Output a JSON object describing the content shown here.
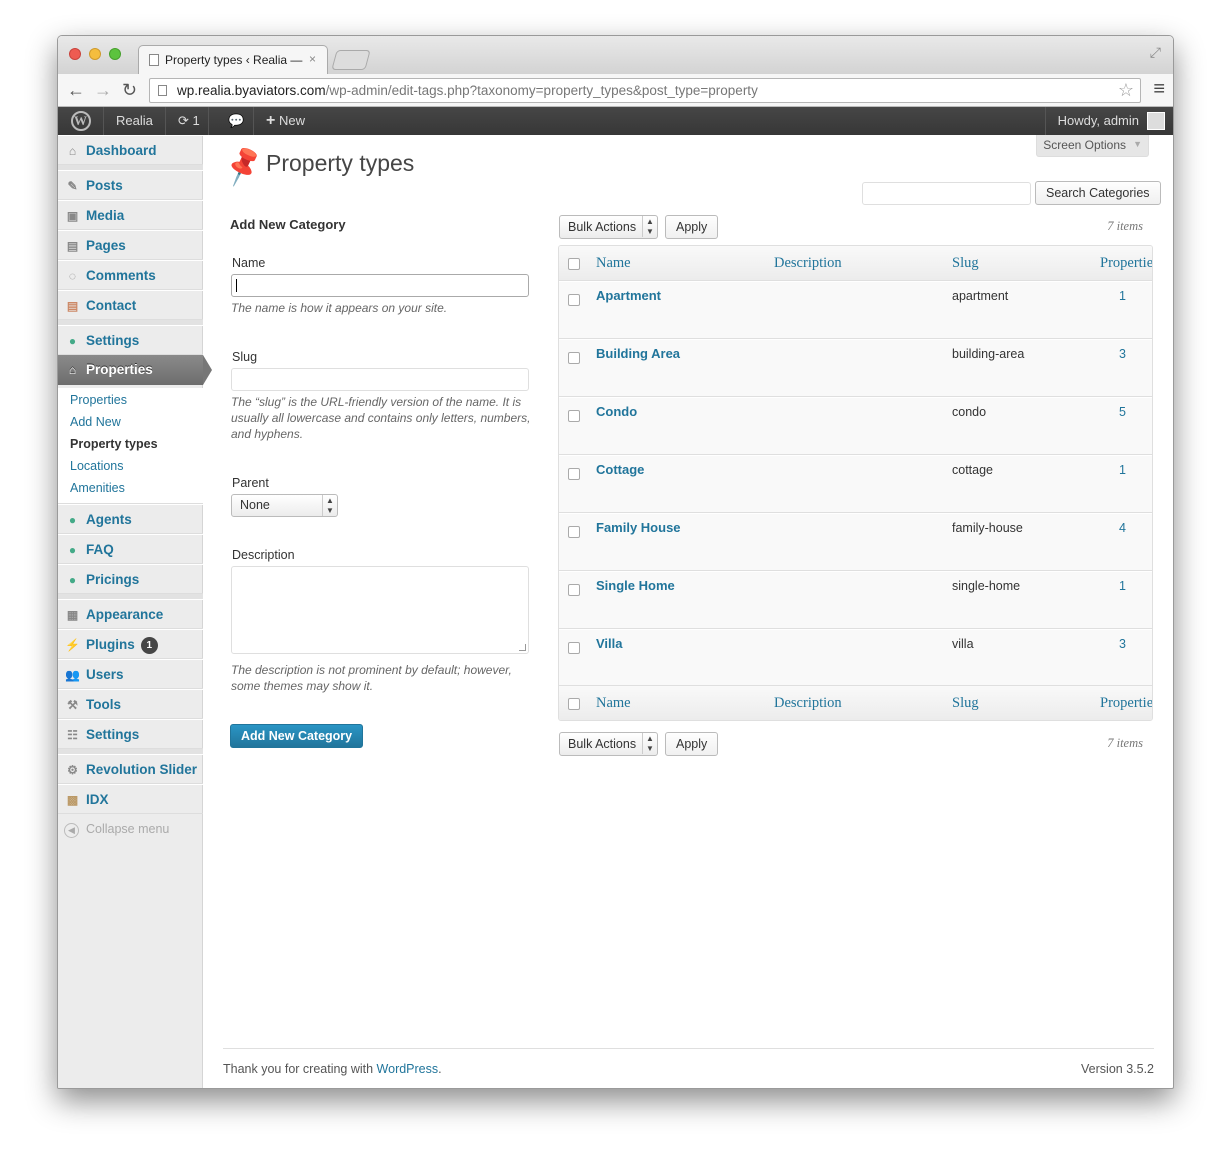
{
  "browser": {
    "tab_title": "Property types ‹ Realia — V",
    "tab_close": "×",
    "url_domain": "wp.realia.byaviators.com",
    "url_path": "/wp-admin/edit-tags.php?taxonomy=property_types&post_type=property"
  },
  "adminbar": {
    "site_name": "Realia",
    "updates_count": "1",
    "new_label": "New",
    "howdy": "Howdy, admin"
  },
  "sidebar": {
    "dashboard": "Dashboard",
    "posts": "Posts",
    "media": "Media",
    "pages": "Pages",
    "comments": "Comments",
    "contact": "Contact",
    "settings_top": "Settings",
    "properties": "Properties",
    "submenu": [
      "Properties",
      "Add New",
      "Property types",
      "Locations",
      "Amenities"
    ],
    "agents": "Agents",
    "faq": "FAQ",
    "pricings": "Pricings",
    "appearance": "Appearance",
    "plugins": "Plugins",
    "plugins_badge": "1",
    "users": "Users",
    "tools": "Tools",
    "settings": "Settings",
    "revolution_slider": "Revolution Slider",
    "idx": "IDX",
    "collapse": "Collapse menu"
  },
  "page": {
    "screen_options": "Screen Options",
    "title": "Property types",
    "search_button": "Search Categories"
  },
  "form": {
    "heading": "Add New Category",
    "name_label": "Name",
    "name_help": "The name is how it appears on your site.",
    "slug_label": "Slug",
    "slug_help": "The “slug” is the URL-friendly version of the name. It is usually all lowercase and contains only letters, numbers, and hyphens.",
    "parent_label": "Parent",
    "parent_value": "None",
    "description_label": "Description",
    "description_help": "The description is not prominent by default; however, some themes may show it.",
    "submit": "Add New Category"
  },
  "table": {
    "bulk_actions": "Bulk Actions",
    "apply": "Apply",
    "items_count": "7 items",
    "columns": [
      "Name",
      "Description",
      "Slug",
      "Properties"
    ],
    "rows": [
      {
        "name": "Apartment",
        "slug": "apartment",
        "count": "1"
      },
      {
        "name": "Building Area",
        "slug": "building-area",
        "count": "3"
      },
      {
        "name": "Condo",
        "slug": "condo",
        "count": "5"
      },
      {
        "name": "Cottage",
        "slug": "cottage",
        "count": "1"
      },
      {
        "name": "Family House",
        "slug": "family-house",
        "count": "4"
      },
      {
        "name": "Single Home",
        "slug": "single-home",
        "count": "1"
      },
      {
        "name": "Villa",
        "slug": "villa",
        "count": "3"
      }
    ]
  },
  "footer": {
    "thanks_prefix": "Thank you for creating with ",
    "link": "WordPress",
    "suffix": ".",
    "version": "Version 3.5.2"
  }
}
